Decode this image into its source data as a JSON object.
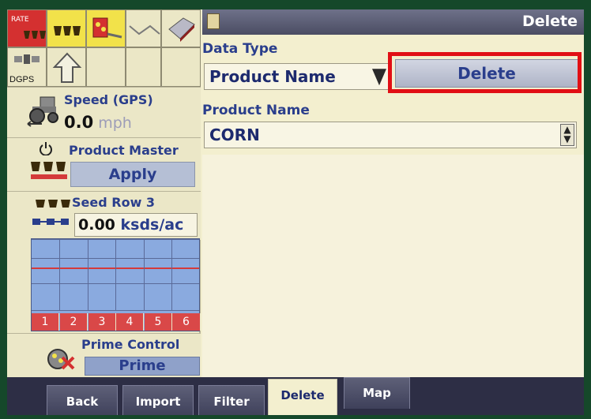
{
  "header": {
    "title": "Delete",
    "icon": "folder-icon"
  },
  "left_panel": {
    "rate_label": "RATE",
    "dgps_label": "DGPS",
    "speed": {
      "label": "Speed (GPS)",
      "value": "0.0",
      "unit": "mph"
    },
    "product_master": {
      "label": "Product Master",
      "button": "Apply"
    },
    "seed_row": {
      "label": "Seed Row 3",
      "value": "0.00",
      "unit": "ksds/ac"
    },
    "rows": [
      "1",
      "2",
      "3",
      "4",
      "5",
      "6"
    ],
    "prime_control": {
      "label": "Prime Control",
      "button": "Prime"
    }
  },
  "main": {
    "data_type": {
      "label": "Data Type",
      "value": "Product Name"
    },
    "delete_button": "Delete",
    "product_name": {
      "label": "Product Name",
      "value": "CORN"
    }
  },
  "tabs": [
    {
      "label": "Back"
    },
    {
      "label": "Import"
    },
    {
      "label": "Filter"
    },
    {
      "label": "Delete",
      "active": true
    },
    {
      "label": "Map"
    }
  ],
  "colors": {
    "accent": "#2a3e8c",
    "highlight": "#e10f15",
    "background": "#f3efcf"
  }
}
